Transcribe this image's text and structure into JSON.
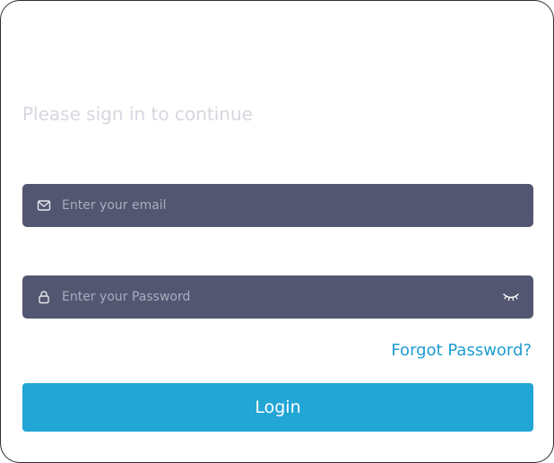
{
  "login_form": {
    "subtitle": "Please sign in to continue",
    "email": {
      "placeholder": "Enter your email",
      "value": "",
      "icon": "mail-icon"
    },
    "password": {
      "placeholder": "Enter your Password",
      "value": "",
      "icon": "lock-icon",
      "toggle_icon": "eye-closed-icon"
    },
    "forgot_password_label": "Forgot Password?",
    "login_button_label": "Login"
  },
  "colors": {
    "field_background": "#535670",
    "accent": "#22a6d5",
    "link": "#1f9dd0",
    "subtitle": "#d6d8e0",
    "placeholder": "#a9acbd"
  }
}
